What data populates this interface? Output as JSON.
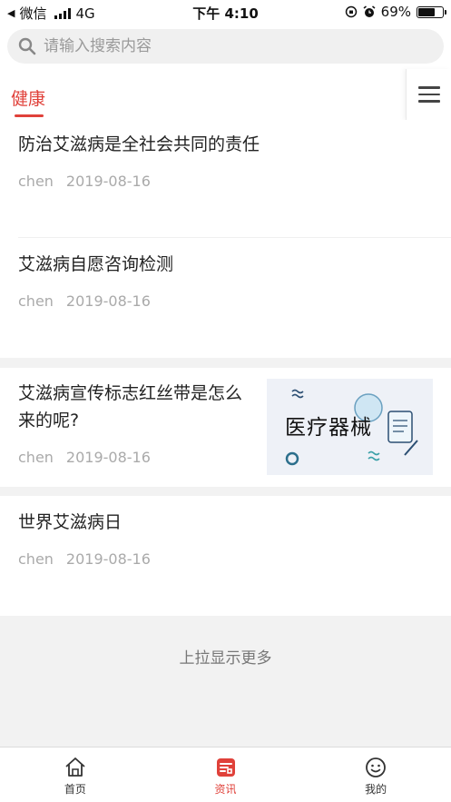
{
  "status_bar": {
    "back_glyph": "◀",
    "carrier": "微信",
    "network": "4G",
    "time": "下午 4:10",
    "battery_text": "69%",
    "battery_level": 0.69
  },
  "search": {
    "placeholder": "请输入搜索内容"
  },
  "tabs": {
    "active_label": "健康"
  },
  "articles": [
    {
      "title": "防治艾滋病是全社会共同的责任",
      "author": "chen",
      "date": "2019-08-16"
    },
    {
      "title": "艾滋病自愿咨询检测",
      "author": "chen",
      "date": "2019-08-16"
    },
    {
      "title_line1": "艾滋病宣传标志红丝带是怎么",
      "title_line2": "来的呢?",
      "author": "chen",
      "date": "2019-08-16",
      "thumbnail_text": "医疗器械"
    },
    {
      "title": "世界艾滋病日",
      "author": "chen",
      "date": "2019-08-16"
    }
  ],
  "load_more": "上拉显示更多",
  "bottom_nav": [
    {
      "label": "首页",
      "icon": "home-icon",
      "active": false
    },
    {
      "label": "资讯",
      "icon": "news-icon",
      "active": true
    },
    {
      "label": "我的",
      "icon": "smiley-icon",
      "active": false
    }
  ],
  "colors": {
    "accent": "#e0413a",
    "text": "#222222",
    "meta": "#aaaaaa",
    "background": "#f2f2f2"
  }
}
